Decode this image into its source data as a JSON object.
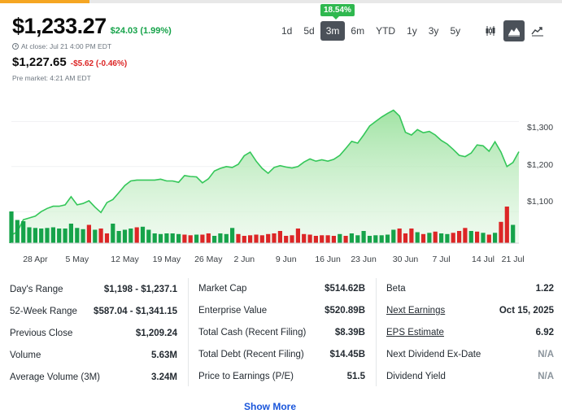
{
  "quote": {
    "price": "$1,233.27",
    "change": "$24.03 (1.99%)",
    "at_close": "At close: Jul 21 4:00 PM EDT",
    "pre_price": "$1,227.65",
    "pre_change": "-$5.62 (-0.46%)",
    "pre_label": "Pre market: 4:21 AM EDT"
  },
  "range_badge": "18.54%",
  "ranges": [
    "1d",
    "5d",
    "3m",
    "6m",
    "YTD",
    "1y",
    "3y",
    "5y"
  ],
  "active_range": "3m",
  "chart_type_icons": [
    "candlestick-icon",
    "mountain-chart-icon",
    "line-chart-icon"
  ],
  "colors": {
    "up": "#16a34a",
    "down": "#dc2626",
    "area_line": "#34c759",
    "area_fill": "#c8f0c9"
  },
  "chart_data": {
    "type": "area",
    "y_ticks": [
      "$1,300",
      "$1,200",
      "$1,100"
    ],
    "y_tick_values": [
      1300,
      1200,
      1100
    ],
    "ylim": [
      1030,
      1335
    ],
    "x_labels": [
      "28 Apr",
      "5 May",
      "12 May",
      "19 May",
      "26 May",
      "2 Jun",
      "9 Jun",
      "16 Jun",
      "23 Jun",
      "30 Jun",
      "7 Jul",
      "14 Jul",
      "21 Jul"
    ],
    "x_label_index": [
      4,
      11,
      19,
      26,
      33,
      39,
      46,
      53,
      59,
      66,
      72,
      79,
      84
    ],
    "prices": [
      1048,
      1055,
      1082,
      1086,
      1090,
      1100,
      1107,
      1112,
      1112,
      1115,
      1133,
      1115,
      1118,
      1124,
      1110,
      1098,
      1120,
      1127,
      1142,
      1158,
      1168,
      1170,
      1170,
      1170,
      1170,
      1172,
      1168,
      1168,
      1165,
      1180,
      1178,
      1177,
      1164,
      1173,
      1190,
      1196,
      1200,
      1198,
      1205,
      1224,
      1232,
      1212,
      1196,
      1185,
      1198,
      1202,
      1199,
      1197,
      1200,
      1210,
      1217,
      1212,
      1215,
      1212,
      1216,
      1225,
      1240,
      1256,
      1252,
      1270,
      1290,
      1300,
      1310,
      1318,
      1325,
      1312,
      1276,
      1270,
      1282,
      1275,
      1278,
      1270,
      1258,
      1250,
      1238,
      1225,
      1222,
      1230,
      1248,
      1246,
      1234,
      1255,
      1232,
      1200,
      1209,
      1233
    ],
    "volume": [
      0.52,
      0.38,
      0.36,
      0.26,
      0.25,
      0.24,
      0.25,
      0.26,
      0.24,
      0.24,
      0.32,
      0.25,
      0.23,
      0.3,
      0.22,
      0.24,
      0.16,
      0.32,
      0.2,
      0.22,
      0.24,
      0.26,
      0.27,
      0.22,
      0.16,
      0.15,
      0.16,
      0.16,
      0.15,
      0.14,
      0.13,
      0.14,
      0.14,
      0.16,
      0.12,
      0.16,
      0.15,
      0.25,
      0.15,
      0.12,
      0.13,
      0.14,
      0.13,
      0.15,
      0.16,
      0.2,
      0.12,
      0.13,
      0.24,
      0.15,
      0.14,
      0.12,
      0.13,
      0.13,
      0.12,
      0.15,
      0.12,
      0.16,
      0.13,
      0.2,
      0.12,
      0.13,
      0.13,
      0.14,
      0.22,
      0.24,
      0.16,
      0.24,
      0.18,
      0.15,
      0.17,
      0.19,
      0.16,
      0.15,
      0.17,
      0.2,
      0.25,
      0.2,
      0.19,
      0.17,
      0.14,
      0.17,
      0.35,
      0.6,
      0.3
    ],
    "volume_up": [
      true,
      true,
      true,
      true,
      true,
      true,
      true,
      true,
      true,
      true,
      true,
      true,
      true,
      false,
      true,
      false,
      false,
      true,
      true,
      true,
      true,
      false,
      true,
      true,
      true,
      true,
      true,
      true,
      true,
      false,
      false,
      true,
      false,
      false,
      true,
      true,
      true,
      true,
      false,
      false,
      false,
      false,
      false,
      false,
      false,
      false,
      false,
      false,
      false,
      false,
      false,
      false,
      false,
      false,
      false,
      true,
      false,
      true,
      true,
      true,
      true,
      true,
      true,
      true,
      true,
      false,
      false,
      false,
      true,
      false,
      true,
      false,
      true,
      true,
      false,
      false,
      false,
      true,
      false,
      true,
      false,
      true,
      false,
      false,
      true
    ]
  },
  "stats": {
    "col1": [
      {
        "label": "Day's Range",
        "value": "$1,198 - $1,237.1"
      },
      {
        "label": "52-Week Range",
        "value": "$587.04 - $1,341.15"
      },
      {
        "label": "Previous Close",
        "value": "$1,209.24"
      },
      {
        "label": "Volume",
        "value": "5.63M"
      },
      {
        "label": "Average Volume (3M)",
        "value": "3.24M"
      }
    ],
    "col2": [
      {
        "label": "Market Cap",
        "value": "$514.62B"
      },
      {
        "label": "Enterprise Value",
        "value": "$520.89B"
      },
      {
        "label": "Total Cash (Recent Filing)",
        "value": "$8.39B"
      },
      {
        "label": "Total Debt (Recent Filing)",
        "value": "$14.45B"
      },
      {
        "label": "Price to Earnings (P/E)",
        "value": "51.5"
      }
    ],
    "col3": [
      {
        "label": "Beta",
        "value": "1.22"
      },
      {
        "label": "Next Earnings",
        "value": "Oct 15, 2025"
      },
      {
        "label": "EPS Estimate",
        "value": "6.92"
      },
      {
        "label": "Next Dividend Ex-Date",
        "value": "N/A"
      },
      {
        "label": "Dividend Yield",
        "value": "N/A"
      }
    ]
  },
  "show_more": "Show More"
}
